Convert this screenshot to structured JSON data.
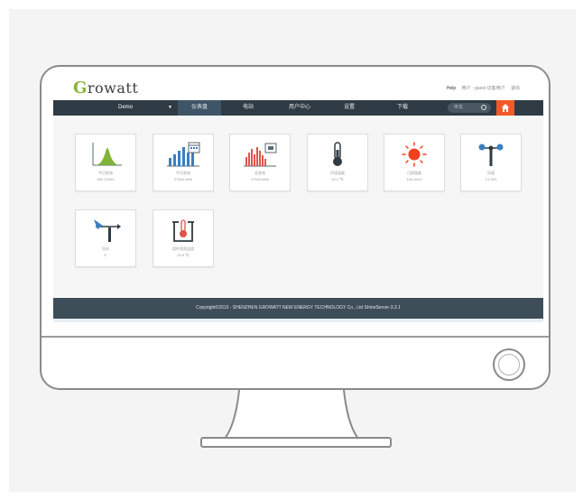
{
  "header": {
    "logo_initial": "G",
    "logo_rest": "rowatt",
    "help": "Help",
    "user_info": "用户 - guest 访客用户",
    "logout": "退出"
  },
  "navbar": {
    "plant": "Demo",
    "items": [
      "仪表盘",
      "电站",
      "用户中心",
      "设置",
      "下载"
    ],
    "active_index": 0,
    "search_placeholder": "中文"
  },
  "tiles": [
    {
      "label": "今日发电",
      "value": "582.3 kWh",
      "icon": "area-chart-icon"
    },
    {
      "label": "今月发电",
      "value": "27649 kWh",
      "icon": "bar-calendar-icon"
    },
    {
      "label": "总发电",
      "value": "27649 kWh",
      "icon": "bar-chart-total-icon"
    },
    {
      "label": "环境温度",
      "value": "30.2 ℃",
      "icon": "thermometer-icon"
    },
    {
      "label": "日照强度",
      "value": "145 w/m2",
      "icon": "sun-icon"
    },
    {
      "label": "风速",
      "value": "3.2 M/s",
      "icon": "anemometer-icon"
    },
    {
      "label": "风向",
      "value": "3°",
      "icon": "wind-vane-icon"
    },
    {
      "label": "组件背面温度",
      "value": "29.5 ℃",
      "icon": "panel-temperature-icon"
    }
  ],
  "footer": {
    "copyright": "Copyright©2015 - SHENZHEN GROWATT NEW ENERGY TECHNOLOGY Co., Ltd ShineServer-3.3.1"
  },
  "colors": {
    "brand_green": "#8ab33a",
    "navbar": "#2f3b44",
    "home_orange": "#f05a28",
    "footer": "#3d4e59",
    "chart_blue": "#3a7fc1",
    "chart_red": "#e0524a",
    "sun_red": "#f0401e"
  }
}
